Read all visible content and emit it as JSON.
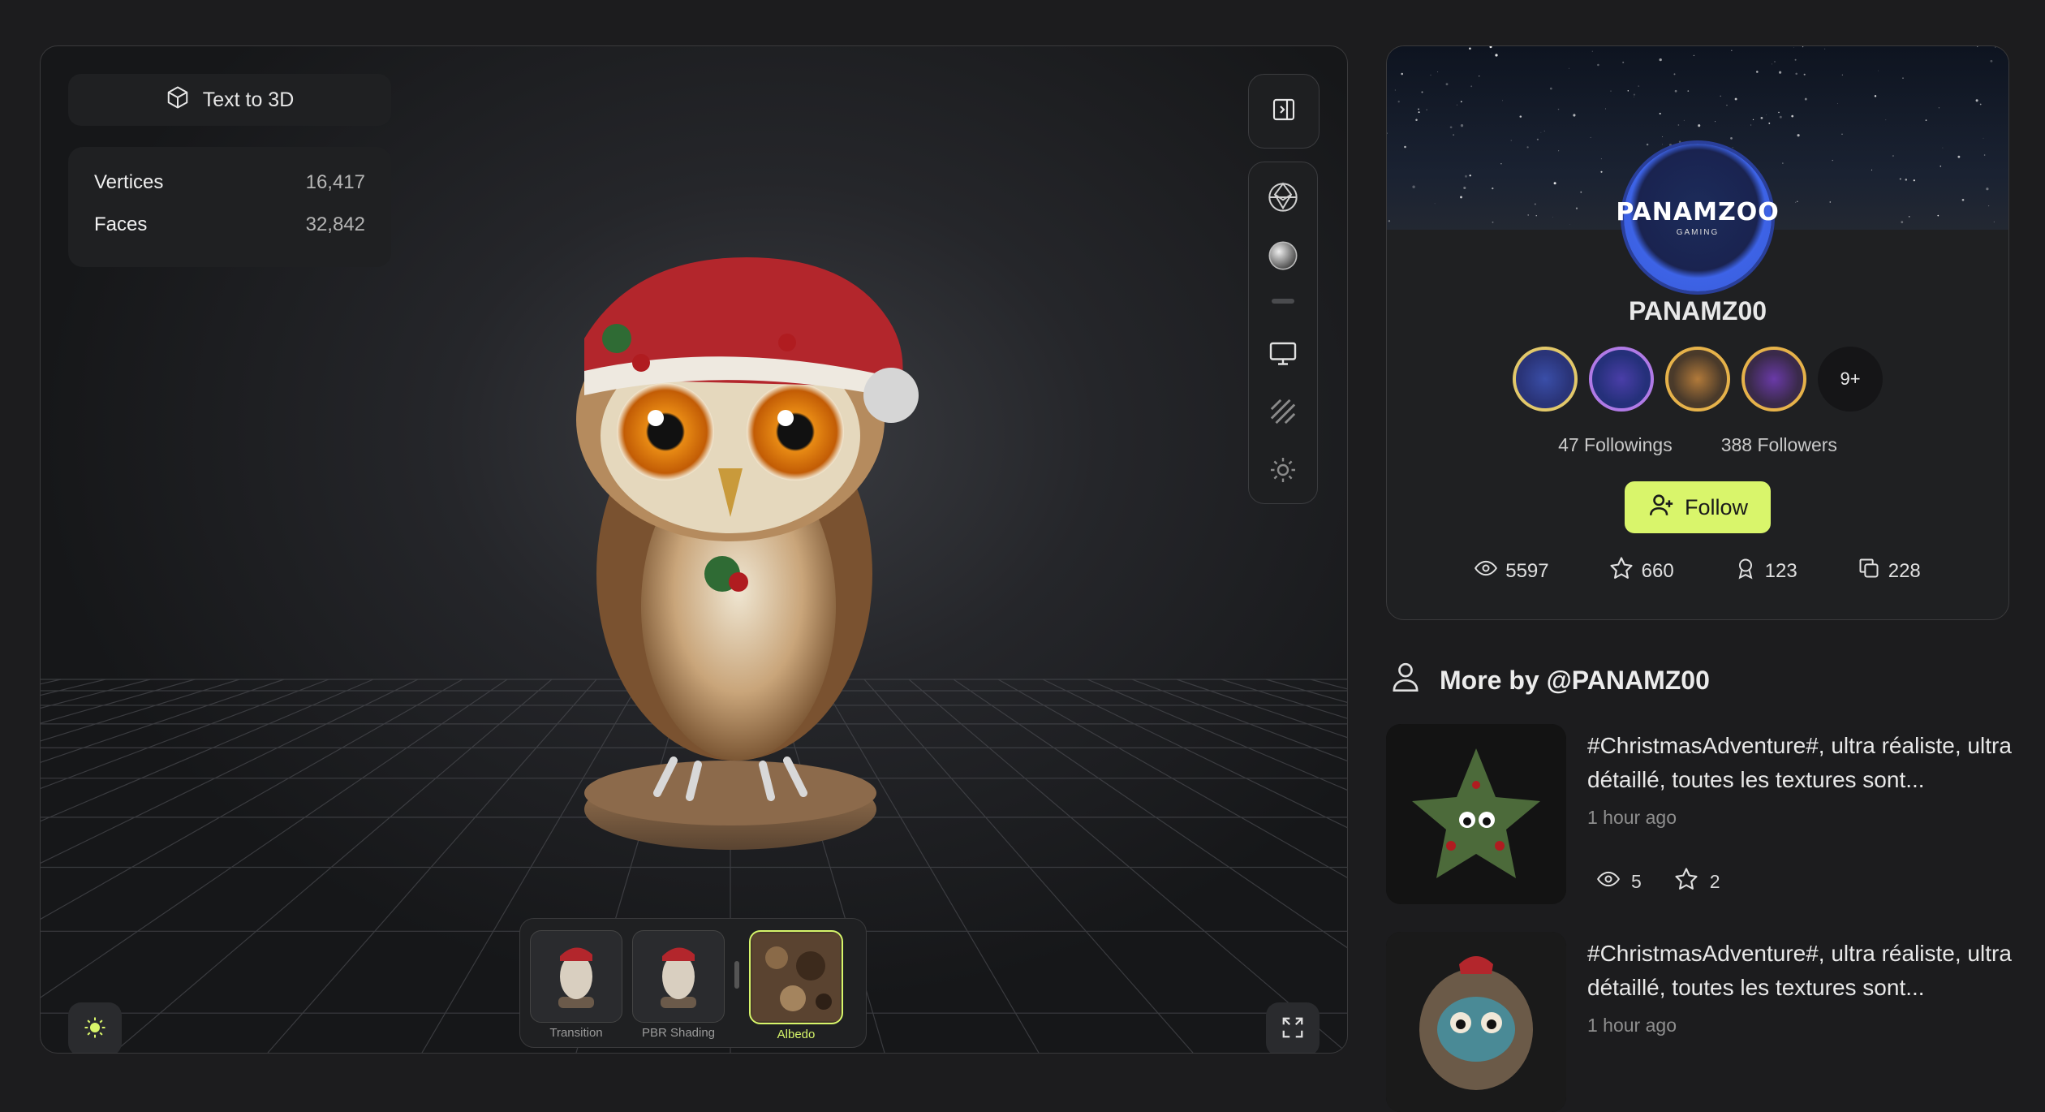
{
  "viewer": {
    "mode_label": "Text to 3D",
    "stats": [
      {
        "label": "Vertices",
        "value": "16,417"
      },
      {
        "label": "Faces",
        "value": "32,842"
      }
    ],
    "thumbnails": [
      {
        "label": "Transition",
        "active": false
      },
      {
        "label": "PBR Shading",
        "active": false
      },
      {
        "label": "Albedo",
        "active": true
      }
    ]
  },
  "profile": {
    "name": "PANAMZ00",
    "avatar_text": "PANAMZOO",
    "avatar_subtext": "GAMING",
    "badges_more": "9+",
    "followings": "47 Followings",
    "followers": "388 Followers",
    "follow_label": "Follow",
    "views": "5597",
    "stars": "660",
    "awards": "123",
    "copies": "228"
  },
  "more_by": {
    "title": "More by @PANAMZ00",
    "items": [
      {
        "title": "#ChristmasAdventure#, ultra réaliste, ultra détaillé, toutes les textures sont...",
        "time": "1 hour ago",
        "views": "5",
        "stars": "2"
      },
      {
        "title": "#ChristmasAdventure#, ultra réaliste, ultra détaillé, toutes les textures sont...",
        "time": "1 hour ago"
      }
    ]
  },
  "colors": {
    "accent": "#d9f56b",
    "background": "#1c1c1e",
    "card": "#1f2022"
  }
}
